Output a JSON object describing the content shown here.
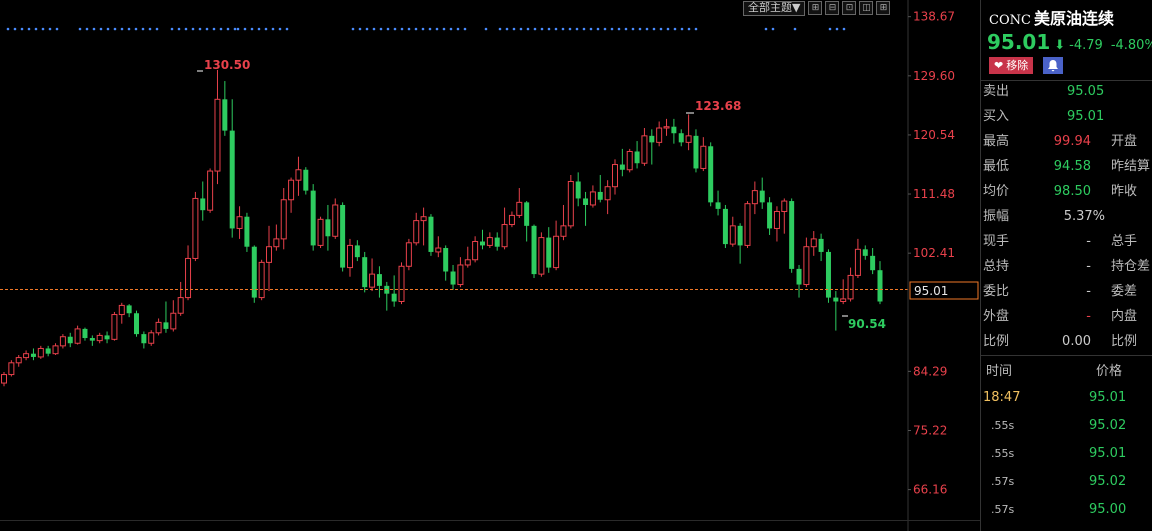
{
  "toolbar": {
    "theme_label": "全部主题▼",
    "buttons": [
      "⊞",
      "⊟",
      "⊡",
      "◫",
      "⊞"
    ]
  },
  "chart_data": {
    "type": "candlestick",
    "y_ticks": [
      "138.67",
      "129.60",
      "120.54",
      "111.48",
      "102.41",
      "84.29",
      "75.22",
      "66.16"
    ],
    "ylim": [
      61.5,
      140
    ],
    "current_price": "95.01",
    "high_label": "130.50",
    "high2_label": "123.68",
    "low_label": "90.54",
    "candles": [
      [
        82.5,
        83.8,
        82.0,
        84.2
      ],
      [
        83.8,
        85.6,
        83.5,
        86.0
      ],
      [
        85.6,
        86.4,
        85.0,
        86.8
      ],
      [
        86.4,
        87.0,
        86.0,
        87.5
      ],
      [
        87.0,
        86.5,
        86.0,
        87.8
      ],
      [
        86.5,
        87.8,
        86.2,
        88.2
      ],
      [
        87.8,
        87.0,
        86.6,
        88.2
      ],
      [
        87.0,
        88.2,
        86.8,
        88.6
      ],
      [
        88.2,
        89.6,
        87.8,
        90.0
      ],
      [
        89.6,
        88.6,
        88.0,
        90.2
      ],
      [
        88.6,
        90.8,
        88.4,
        91.3
      ],
      [
        90.8,
        89.4,
        89.0,
        91.0
      ],
      [
        89.4,
        89.0,
        88.2,
        89.8
      ],
      [
        89.0,
        89.8,
        88.6,
        90.2
      ],
      [
        89.8,
        89.2,
        88.6,
        90.4
      ],
      [
        89.2,
        93.0,
        89.0,
        93.4
      ],
      [
        93.0,
        94.4,
        91.6,
        94.8
      ],
      [
        94.4,
        93.2,
        92.6,
        94.6
      ],
      [
        93.2,
        90.0,
        89.6,
        93.6
      ],
      [
        90.0,
        88.6,
        87.8,
        90.4
      ],
      [
        88.6,
        90.2,
        88.2,
        90.6
      ],
      [
        90.2,
        91.8,
        89.8,
        92.4
      ],
      [
        91.8,
        90.8,
        90.2,
        95.0
      ],
      [
        90.8,
        93.2,
        90.4,
        95.2
      ],
      [
        93.2,
        95.6,
        92.8,
        98.0
      ],
      [
        95.6,
        101.6,
        95.2,
        103.6
      ],
      [
        101.6,
        110.8,
        101.2,
        111.8
      ],
      [
        110.8,
        109.0,
        107.4,
        113.4
      ],
      [
        109.0,
        115.0,
        108.6,
        115.4
      ],
      [
        115.0,
        126.0,
        113.0,
        130.5
      ],
      [
        126.0,
        121.2,
        120.4,
        128.8
      ],
      [
        121.2,
        106.2,
        104.8,
        126.0
      ],
      [
        106.2,
        108.0,
        104.6,
        109.6
      ],
      [
        108.0,
        103.4,
        102.6,
        108.6
      ],
      [
        103.4,
        95.6,
        94.8,
        103.6
      ],
      [
        95.6,
        101.0,
        95.2,
        101.4
      ],
      [
        101.0,
        103.4,
        96.6,
        106.6
      ],
      [
        103.4,
        104.6,
        102.8,
        106.8
      ],
      [
        104.6,
        110.6,
        103.0,
        112.4
      ],
      [
        110.6,
        113.6,
        108.6,
        114.0
      ],
      [
        113.6,
        115.2,
        111.2,
        117.2
      ],
      [
        115.2,
        112.0,
        111.4,
        115.6
      ],
      [
        112.0,
        103.6,
        102.8,
        113.0
      ],
      [
        103.6,
        107.6,
        103.2,
        108.0
      ],
      [
        107.6,
        105.0,
        102.8,
        109.8
      ],
      [
        105.0,
        109.8,
        104.6,
        110.8
      ],
      [
        109.8,
        100.2,
        99.6,
        110.2
      ],
      [
        100.2,
        103.6,
        98.8,
        104.6
      ],
      [
        103.6,
        101.8,
        101.2,
        104.4
      ],
      [
        101.8,
        97.2,
        96.4,
        102.6
      ],
      [
        97.2,
        99.2,
        96.6,
        101.6
      ],
      [
        99.2,
        97.4,
        95.6,
        100.4
      ],
      [
        97.4,
        96.2,
        93.6,
        98.0
      ],
      [
        96.2,
        95.0,
        94.2,
        99.0
      ],
      [
        95.0,
        100.4,
        94.6,
        101.0
      ],
      [
        100.4,
        104.0,
        99.8,
        104.6
      ],
      [
        104.0,
        107.4,
        103.6,
        108.6
      ],
      [
        107.4,
        108.0,
        103.6,
        109.4
      ],
      [
        108.0,
        102.6,
        102.0,
        108.4
      ],
      [
        102.6,
        103.2,
        101.8,
        105.0
      ],
      [
        103.2,
        99.6,
        98.2,
        103.6
      ],
      [
        99.6,
        97.6,
        96.8,
        100.6
      ],
      [
        97.6,
        100.6,
        97.2,
        101.8
      ],
      [
        100.6,
        101.4,
        100.2,
        103.4
      ],
      [
        101.4,
        104.2,
        101.0,
        105.0
      ],
      [
        104.2,
        103.6,
        103.0,
        106.0
      ],
      [
        103.6,
        104.8,
        103.2,
        105.6
      ],
      [
        104.8,
        103.4,
        102.8,
        105.6
      ],
      [
        103.4,
        106.8,
        103.0,
        109.4
      ],
      [
        106.8,
        108.2,
        106.4,
        108.8
      ],
      [
        108.2,
        110.2,
        107.8,
        112.4
      ],
      [
        110.2,
        106.6,
        104.2,
        110.4
      ],
      [
        106.6,
        99.2,
        98.6,
        106.8
      ],
      [
        99.2,
        104.8,
        98.8,
        105.6
      ],
      [
        104.8,
        100.2,
        99.4,
        106.4
      ],
      [
        100.2,
        105.0,
        99.8,
        107.4
      ],
      [
        105.0,
        106.6,
        104.4,
        109.8
      ],
      [
        106.6,
        113.4,
        106.2,
        114.4
      ],
      [
        113.4,
        110.8,
        109.6,
        114.8
      ],
      [
        110.8,
        109.8,
        106.6,
        111.8
      ],
      [
        109.8,
        111.8,
        109.4,
        112.8
      ],
      [
        111.8,
        110.6,
        110.2,
        114.4
      ],
      [
        110.6,
        112.6,
        108.4,
        113.6
      ],
      [
        112.6,
        116.0,
        111.4,
        116.8
      ],
      [
        116.0,
        115.2,
        114.2,
        118.4
      ],
      [
        115.2,
        118.0,
        114.8,
        118.4
      ],
      [
        118.0,
        116.2,
        115.4,
        119.6
      ],
      [
        116.2,
        120.4,
        115.8,
        121.6
      ],
      [
        120.4,
        119.4,
        116.0,
        121.4
      ],
      [
        119.4,
        121.6,
        118.8,
        122.6
      ],
      [
        121.6,
        121.8,
        120.4,
        123.0
      ],
      [
        121.8,
        120.8,
        119.2,
        123.0
      ],
      [
        120.8,
        119.4,
        118.8,
        121.4
      ],
      [
        119.4,
        120.4,
        118.2,
        123.68
      ],
      [
        120.4,
        115.4,
        114.8,
        121.4
      ],
      [
        115.4,
        118.8,
        115.0,
        120.2
      ],
      [
        118.8,
        110.2,
        109.6,
        119.4
      ],
      [
        110.2,
        109.2,
        108.2,
        112.0
      ],
      [
        109.2,
        103.8,
        103.2,
        109.8
      ],
      [
        103.8,
        106.6,
        103.4,
        108.0
      ],
      [
        106.6,
        103.6,
        100.8,
        107.0
      ],
      [
        103.6,
        110.0,
        103.2,
        110.4
      ],
      [
        110.0,
        112.0,
        108.4,
        113.4
      ],
      [
        112.0,
        110.2,
        109.2,
        114.0
      ],
      [
        110.2,
        106.2,
        105.2,
        111.0
      ],
      [
        106.2,
        108.8,
        104.2,
        109.6
      ],
      [
        108.8,
        110.4,
        105.4,
        110.8
      ],
      [
        110.4,
        100.0,
        99.4,
        110.8
      ],
      [
        100.0,
        97.6,
        95.6,
        100.6
      ],
      [
        97.6,
        103.4,
        97.2,
        104.8
      ],
      [
        103.4,
        104.6,
        102.0,
        105.8
      ],
      [
        104.6,
        102.6,
        101.2,
        105.4
      ],
      [
        102.6,
        95.6,
        94.8,
        103.0
      ],
      [
        95.6,
        95.0,
        90.54,
        96.6
      ],
      [
        95.0,
        95.4,
        94.6,
        98.4
      ],
      [
        95.4,
        99.0,
        95.0,
        100.2
      ],
      [
        99.0,
        103.0,
        98.6,
        104.6
      ],
      [
        103.0,
        102.0,
        101.4,
        103.6
      ],
      [
        102.0,
        99.8,
        99.2,
        103.2
      ],
      [
        99.8,
        95.0,
        94.6,
        101.2
      ]
    ],
    "dot_segments": [
      [
        8,
        62
      ],
      [
        80,
        163
      ],
      [
        172,
        235
      ],
      [
        238,
        290
      ],
      [
        353,
        465
      ],
      [
        486,
        490
      ],
      [
        500,
        700
      ],
      [
        766,
        777
      ],
      [
        795,
        797
      ],
      [
        830,
        847
      ]
    ]
  },
  "panel": {
    "code": "CONC",
    "name": "美原油连续",
    "price": "95.01",
    "change": "-4.79",
    "change_pct": "-4.80%",
    "remove_label": "移除",
    "stats": [
      {
        "label": "卖出",
        "value": "95.05",
        "cls": "down",
        "label2": ""
      },
      {
        "label": "买入",
        "value": "95.01",
        "cls": "down",
        "label2": ""
      },
      {
        "label": "最高",
        "value": "99.94",
        "cls": "up",
        "label2": "开盘"
      },
      {
        "label": "最低",
        "value": "94.58",
        "cls": "down",
        "label2": "昨结算"
      },
      {
        "label": "均价",
        "value": "98.50",
        "cls": "down",
        "label2": "昨收"
      },
      {
        "label": "振幅",
        "value": "5.37%",
        "cls": "neutral",
        "label2": ""
      },
      {
        "label": "现手",
        "value": "-",
        "cls": "neutral",
        "label2": "总手"
      },
      {
        "label": "总持",
        "value": "-",
        "cls": "neutral",
        "label2": "持仓差"
      },
      {
        "label": "委比",
        "value": "-",
        "cls": "neutral",
        "label2": "委差"
      },
      {
        "label": "外盘",
        "value": "-",
        "cls": "up",
        "label2": "内盘"
      },
      {
        "label": "比例",
        "value": "0.00",
        "cls": "neutral",
        "label2": "比例"
      }
    ],
    "ts_headers": [
      "时间",
      "价格"
    ],
    "ticks": [
      {
        "time": "18:47",
        "price": "95.01"
      },
      {
        "time": ".55s",
        "price": "95.02"
      },
      {
        "time": ".55s",
        "price": "95.01"
      },
      {
        "time": ".57s",
        "price": "95.02"
      },
      {
        "time": ".57s",
        "price": "95.00"
      }
    ]
  },
  "colors": {
    "up": "#e8414b",
    "down": "#2ecc60",
    "axis_text": "#e8414b",
    "current_line": "#f07828",
    "dots": "#4a8cff"
  }
}
